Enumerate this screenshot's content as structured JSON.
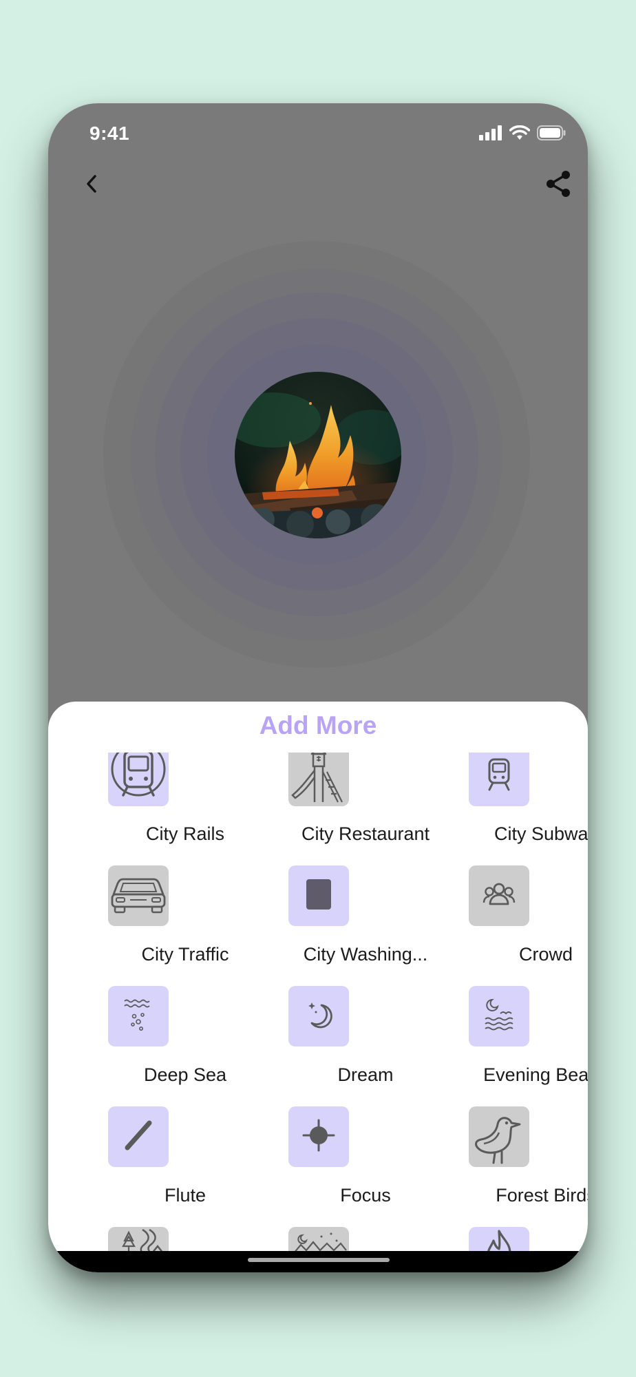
{
  "status_bar": {
    "time": "9:41"
  },
  "icons": {
    "back": "chevron-left-icon",
    "share": "share-icon"
  },
  "player": {
    "artwork": "campfire-image"
  },
  "sheet": {
    "title": "Add More",
    "sounds": [
      {
        "label": "City Rails",
        "icon": "train-front-icon",
        "style": "lavender"
      },
      {
        "label": "City Restaurant",
        "icon": "playground-slide-icon",
        "style": "gray"
      },
      {
        "label": "City Subway",
        "icon": "subway-train-icon",
        "style": "lavender"
      },
      {
        "label": "City Traffic",
        "icon": "car-icon",
        "style": "gray"
      },
      {
        "label": "City Washing...",
        "icon": "stop-square-icon",
        "style": "lavender"
      },
      {
        "label": "Crowd",
        "icon": "people-group-icon",
        "style": "gray"
      },
      {
        "label": "Deep Sea",
        "icon": "waves-bubbles-icon",
        "style": "lavender"
      },
      {
        "label": "Dream",
        "icon": "moon-star-icon",
        "style": "lavender"
      },
      {
        "label": "Evening Beach",
        "icon": "moon-sea-bird-icon",
        "style": "lavender"
      },
      {
        "label": "Flute",
        "icon": "flute-icon",
        "style": "lavender"
      },
      {
        "label": "Focus",
        "icon": "crosshair-icon",
        "style": "lavender"
      },
      {
        "label": "Forest Birds",
        "icon": "bird-icon",
        "style": "gray"
      },
      {
        "label": "",
        "icon": "forest-path-icon",
        "style": "gray"
      },
      {
        "label": "",
        "icon": "night-mountains-icon",
        "style": "gray"
      },
      {
        "label": "",
        "icon": "flame-icon",
        "style": "lavender"
      }
    ]
  },
  "colors": {
    "background": "#d4f0e4",
    "accent": "#b9a3f7",
    "tile_lavender": "#d8d3fb",
    "tile_gray": "#cdcdcd"
  }
}
